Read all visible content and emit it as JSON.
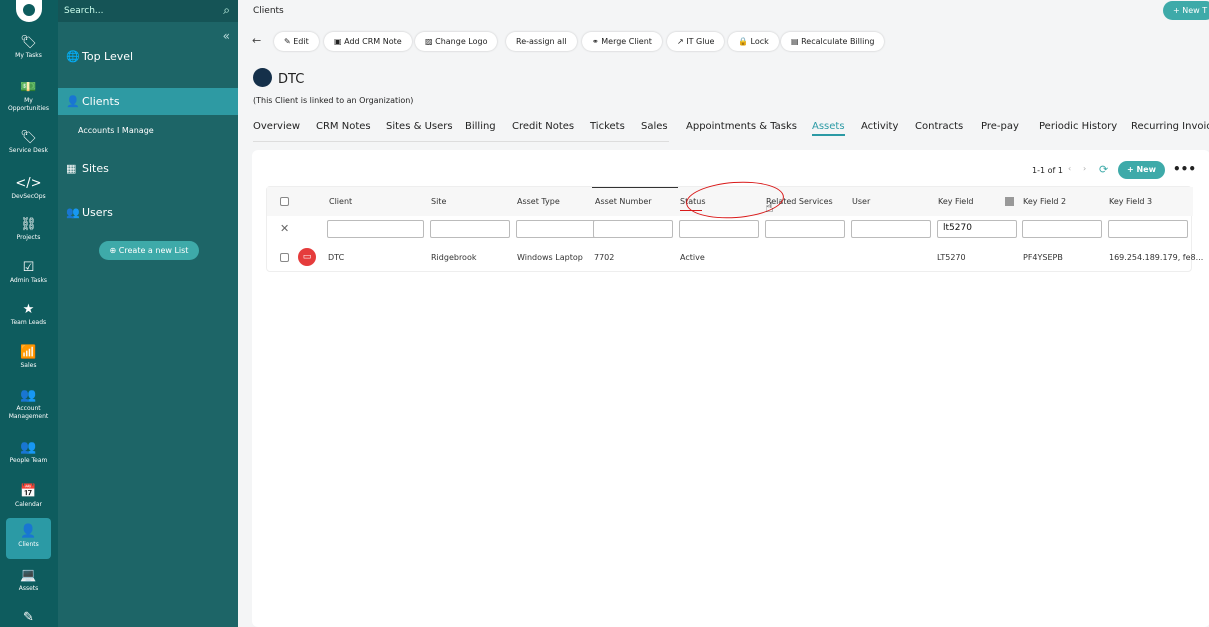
{
  "search": {
    "placeholder": "Search..."
  },
  "rail": {
    "items": [
      {
        "label": "My Tasks",
        "icon": "tag-icon",
        "glyph": "🏷"
      },
      {
        "label": "My Opportunities",
        "icon": "money-icon",
        "glyph": "💵"
      },
      {
        "label": "Service Desk",
        "icon": "ticket-icon",
        "glyph": "🏷"
      },
      {
        "label": "DevSecOps",
        "icon": "code-icon",
        "glyph": "</>"
      },
      {
        "label": "Projects",
        "icon": "sitemap-icon",
        "glyph": "⛓"
      },
      {
        "label": "Admin Tasks",
        "icon": "checkbox-icon",
        "glyph": "☑"
      },
      {
        "label": "Team Leads",
        "icon": "star-icon",
        "glyph": "★"
      },
      {
        "label": "Sales",
        "icon": "chart-icon",
        "glyph": "📶"
      },
      {
        "label": "Account Management",
        "icon": "users-icon",
        "glyph": "👥"
      },
      {
        "label": "People Team",
        "icon": "users-icon",
        "glyph": "👥"
      },
      {
        "label": "Calendar",
        "icon": "calendar-icon",
        "glyph": "📅"
      },
      {
        "label": "Clients",
        "icon": "user-icon",
        "glyph": "👤"
      },
      {
        "label": "Assets",
        "icon": "laptop-icon",
        "glyph": "💻"
      },
      {
        "label": "",
        "icon": "edit-icon",
        "glyph": "✎"
      }
    ]
  },
  "sidebar": {
    "top_level": "Top Level",
    "clients": "Clients",
    "accounts": "Accounts I Manage",
    "sites": "Sites",
    "users": "Users",
    "create_list": "Create a new List"
  },
  "header": {
    "breadcrumb": "Clients",
    "new_top": "+ New T"
  },
  "toolbar": {
    "edit": "Edit",
    "add_note": "Add CRM Note",
    "change_logo": "Change Logo",
    "reassign": "Re-assign all",
    "merge": "Merge Client",
    "itglue": "IT Glue",
    "lock": "Lock",
    "recalc": "Recalculate Billing"
  },
  "client": {
    "name": "DTC",
    "linked": "(This Client is linked to an Organization)"
  },
  "tabs": [
    "Overview",
    "CRM Notes",
    "Sites & Users",
    "Billing",
    "Credit Notes",
    "Tickets",
    "Sales",
    "Appointments & Tasks",
    "Assets",
    "Activity",
    "Contracts",
    "Pre-pay",
    "Periodic History",
    "Recurring Invoic"
  ],
  "list": {
    "pagination": "1-1 of 1",
    "new": "+ New",
    "more": "•••"
  },
  "columns": [
    "Client",
    "Site",
    "Asset Type",
    "Asset Number",
    "Status",
    "Related Services",
    "User",
    "Key Field",
    "Key Field 2",
    "Key Field 3"
  ],
  "filter": {
    "key_field": "lt5270"
  },
  "row": {
    "client": "DTC",
    "site": "Ridgebrook",
    "asset_type": "Windows Laptop",
    "asset_number": "7702",
    "status": "Active",
    "related": "",
    "user": "",
    "key1": "LT5270",
    "key2": "PF4YSEPB",
    "key3": "169.254.189.179, fe8..."
  },
  "colors": {
    "brand": "#1d6567",
    "accent": "#3eaaa9",
    "annotation": "#d91a1a"
  }
}
